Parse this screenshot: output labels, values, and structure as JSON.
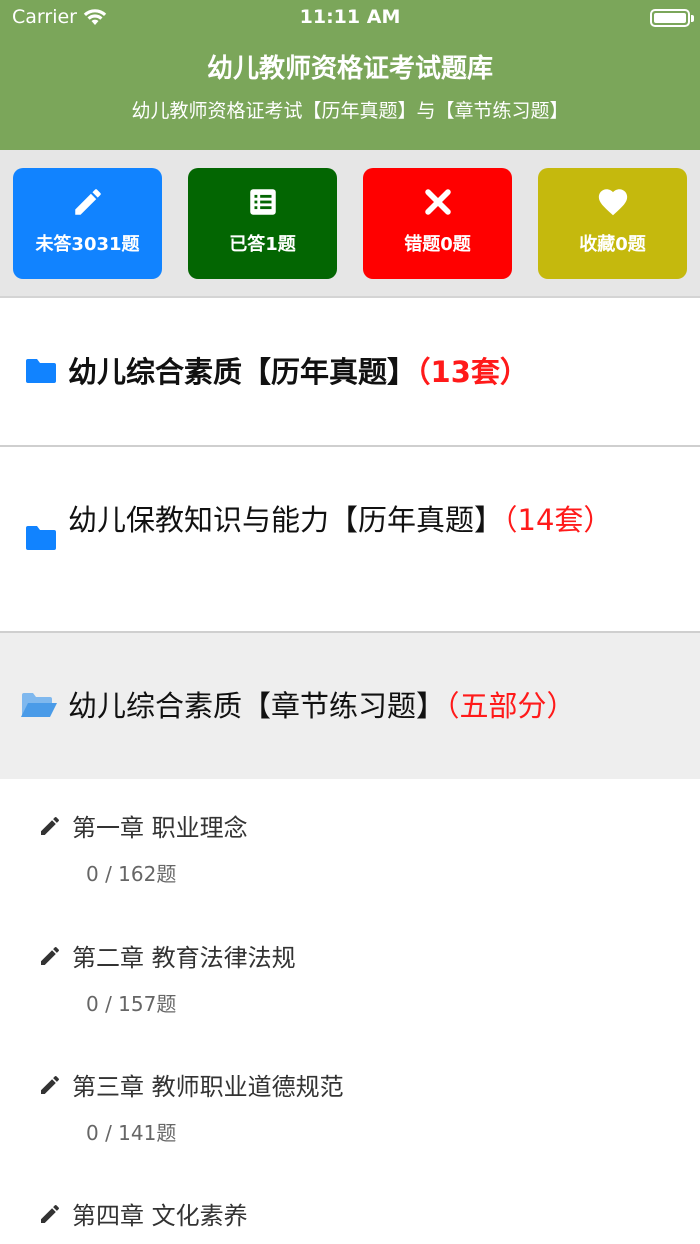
{
  "status_bar": {
    "carrier": "Carrier",
    "time": "11:11 AM"
  },
  "header": {
    "title": "幼儿教师资格证考试题库",
    "subtitle": "幼儿教师资格证考试【历年真题】与【章节练习题】"
  },
  "stats": [
    {
      "label": "未答3031题",
      "icon": "pencil-icon",
      "color": "#1183ff"
    },
    {
      "label": "已答1题",
      "icon": "list-icon",
      "color": "#036602"
    },
    {
      "label": "错题0题",
      "icon": "x-icon",
      "color": "#ff0000"
    },
    {
      "label": "收藏0题",
      "icon": "heart-icon",
      "color": "#c5b90d"
    }
  ],
  "sections": [
    {
      "title": "幼儿综合素质【历年真题】",
      "count": "（13套）"
    },
    {
      "title": "幼儿保教知识与能力【历年真题】",
      "count": "（14套）"
    },
    {
      "title": "幼儿综合素质【章节练习题】",
      "count": "（五部分）"
    }
  ],
  "chapters": [
    {
      "name": "第一章 职业理念",
      "progress": "0 / 162题"
    },
    {
      "name": "第二章 教育法律法规",
      "progress": "0 / 157题"
    },
    {
      "name": "第三章 教师职业道德规范",
      "progress": "0 / 141题"
    },
    {
      "name": "第四章 文化素养",
      "progress": ""
    }
  ],
  "colors": {
    "header": "#7ba65a",
    "folder": "#1183ff",
    "count": "#ff1a1a"
  }
}
